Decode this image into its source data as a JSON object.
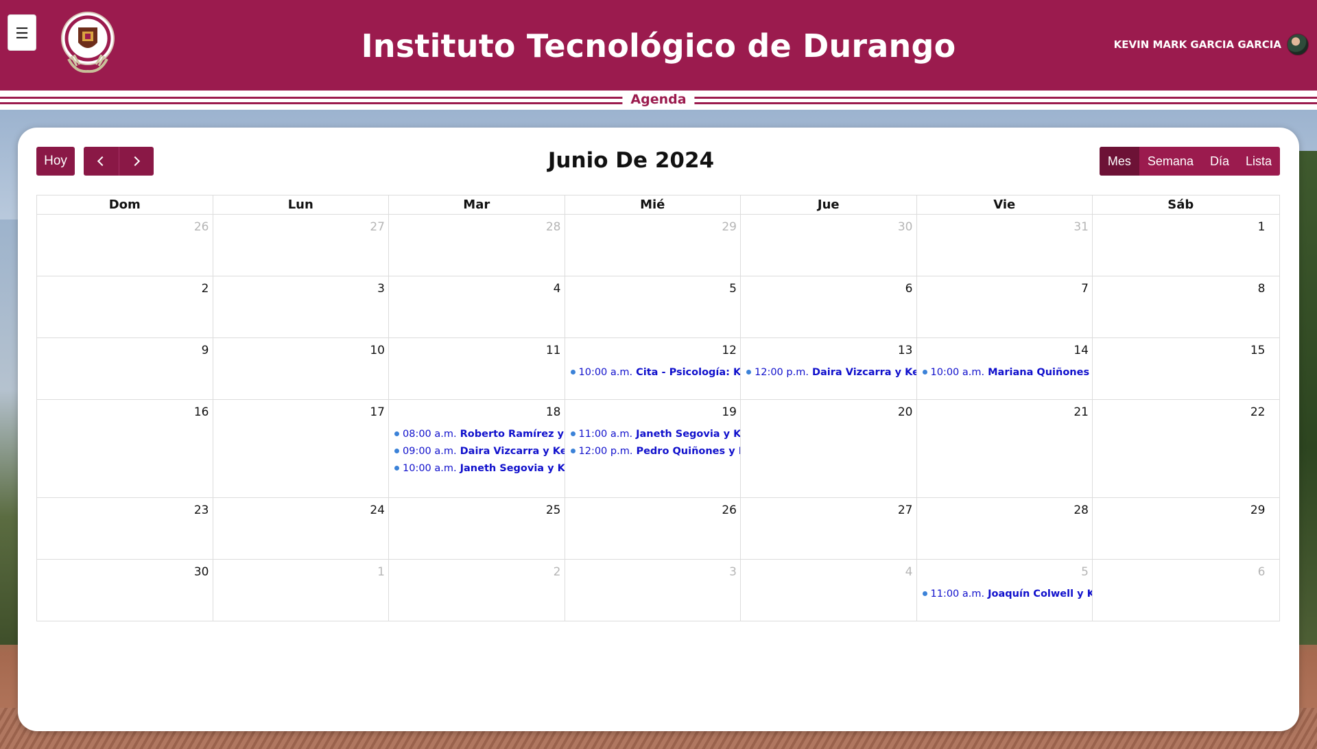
{
  "header": {
    "menu_label": "☰",
    "title": "Instituto Tecnológico de Durango",
    "user_name": "KEVIN MARK GARCIA GARCIA"
  },
  "banner": {
    "label": "Agenda"
  },
  "toolbar": {
    "today_label": "Hoy",
    "month_title": "Junio De 2024",
    "views": [
      "Mes",
      "Semana",
      "Día",
      "Lista"
    ],
    "active_view": "Mes"
  },
  "colors": {
    "brand": "#9b1b4e",
    "brand_dark": "#6d1236",
    "event_text": "#1010cc",
    "event_dot": "#3b82d8"
  },
  "calendar": {
    "weekdays": [
      "Dom",
      "Lun",
      "Mar",
      "Mié",
      "Jue",
      "Vie",
      "Sáb"
    ],
    "weeks": [
      [
        {
          "day": "26",
          "other": true,
          "events": []
        },
        {
          "day": "27",
          "other": true,
          "events": []
        },
        {
          "day": "28",
          "other": true,
          "events": []
        },
        {
          "day": "29",
          "other": true,
          "events": []
        },
        {
          "day": "30",
          "other": true,
          "events": []
        },
        {
          "day": "31",
          "other": true,
          "events": []
        },
        {
          "day": "1",
          "other": false,
          "events": []
        }
      ],
      [
        {
          "day": "2",
          "other": false,
          "events": []
        },
        {
          "day": "3",
          "other": false,
          "events": []
        },
        {
          "day": "4",
          "other": false,
          "events": []
        },
        {
          "day": "5",
          "other": false,
          "events": []
        },
        {
          "day": "6",
          "other": false,
          "events": []
        },
        {
          "day": "7",
          "other": false,
          "events": []
        },
        {
          "day": "8",
          "other": false,
          "events": []
        }
      ],
      [
        {
          "day": "9",
          "other": false,
          "events": []
        },
        {
          "day": "10",
          "other": false,
          "events": []
        },
        {
          "day": "11",
          "other": false,
          "events": []
        },
        {
          "day": "12",
          "other": false,
          "events": [
            {
              "time": "10:00 a.m.",
              "title": "Cita - Psicología: Kevin"
            }
          ]
        },
        {
          "day": "13",
          "other": false,
          "events": [
            {
              "time": "12:00 p.m.",
              "title": "Daira Vizcarra y Kevin M"
            }
          ]
        },
        {
          "day": "14",
          "other": false,
          "events": [
            {
              "time": "10:00 a.m.",
              "title": "Mariana Quiñones y Kevi"
            }
          ]
        },
        {
          "day": "15",
          "other": false,
          "events": []
        }
      ],
      [
        {
          "day": "16",
          "other": false,
          "events": []
        },
        {
          "day": "17",
          "other": false,
          "events": []
        },
        {
          "day": "18",
          "other": false,
          "events": [
            {
              "time": "08:00 a.m.",
              "title": "Roberto Ramírez y Kevin"
            },
            {
              "time": "09:00 a.m.",
              "title": "Daira Vizcarra y Kevin M"
            },
            {
              "time": "10:00 a.m.",
              "title": "Janeth Segovia y Kevin"
            }
          ]
        },
        {
          "day": "19",
          "other": false,
          "events": [
            {
              "time": "11:00 a.m.",
              "title": "Janeth Segovia y Kevin"
            },
            {
              "time": "12:00 p.m.",
              "title": "Pedro Quiñones y Kevin"
            }
          ]
        },
        {
          "day": "20",
          "other": false,
          "events": []
        },
        {
          "day": "21",
          "other": false,
          "events": []
        },
        {
          "day": "22",
          "other": false,
          "events": []
        }
      ],
      [
        {
          "day": "23",
          "other": false,
          "events": []
        },
        {
          "day": "24",
          "other": false,
          "events": []
        },
        {
          "day": "25",
          "other": false,
          "events": []
        },
        {
          "day": "26",
          "other": false,
          "events": []
        },
        {
          "day": "27",
          "other": false,
          "events": []
        },
        {
          "day": "28",
          "other": false,
          "events": []
        },
        {
          "day": "29",
          "other": false,
          "events": []
        }
      ],
      [
        {
          "day": "30",
          "other": false,
          "events": []
        },
        {
          "day": "1",
          "other": true,
          "events": []
        },
        {
          "day": "2",
          "other": true,
          "events": []
        },
        {
          "day": "3",
          "other": true,
          "events": []
        },
        {
          "day": "4",
          "other": true,
          "events": []
        },
        {
          "day": "5",
          "other": true,
          "events": [
            {
              "time": "11:00 a.m.",
              "title": "Joaquín Colwell y Kevin"
            }
          ]
        },
        {
          "day": "6",
          "other": true,
          "events": []
        }
      ]
    ]
  }
}
